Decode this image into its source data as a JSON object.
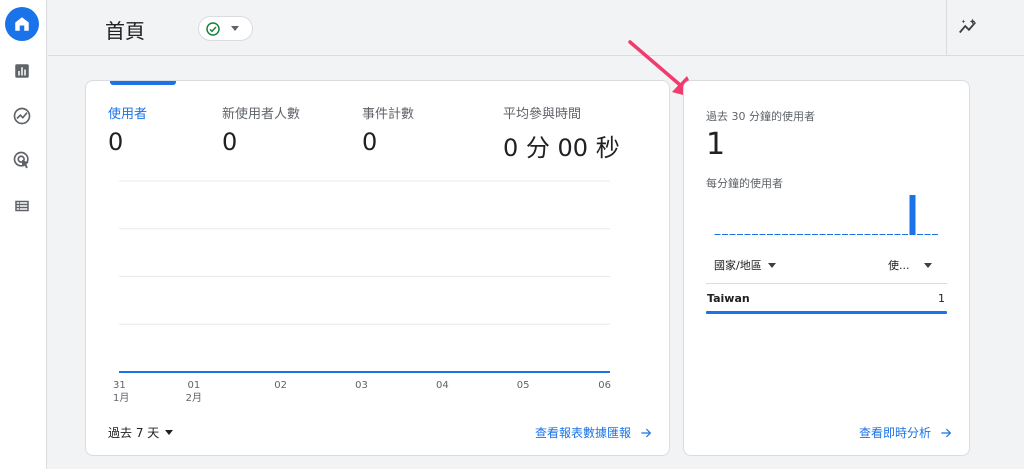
{
  "header": {
    "title": "首頁"
  },
  "sidenav": {
    "items": [
      {
        "icon": "home-icon",
        "active": true
      },
      {
        "icon": "reports-icon"
      },
      {
        "icon": "explore-icon"
      },
      {
        "icon": "advertising-icon"
      },
      {
        "icon": "configure-icon"
      }
    ]
  },
  "overview": {
    "metrics": [
      {
        "label": "使用者",
        "value": "0"
      },
      {
        "label": "新使用者人數",
        "value": "0"
      },
      {
        "label": "事件計數",
        "value": "0"
      },
      {
        "label": "平均參與時間",
        "value": "0 分 00 秒"
      }
    ],
    "date_range": "過去 7 天",
    "view_reports_link": "查看報表數據匯報"
  },
  "chart_data": {
    "type": "line",
    "x_day": [
      "31",
      "01",
      "02",
      "03",
      "04",
      "05",
      "06"
    ],
    "x_month": [
      "1月",
      "2月",
      "",
      "",
      "",
      "",
      ""
    ],
    "series": [
      {
        "values": [
          0,
          0,
          0,
          0,
          0,
          0,
          0
        ]
      }
    ]
  },
  "realtime": {
    "title": "過去 30 分鐘的使用者",
    "value": "1",
    "per_minute_label": "每分鐘的使用者",
    "per_minute_values": [
      0,
      0,
      0,
      0,
      0,
      0,
      0,
      0,
      0,
      0,
      0,
      0,
      0,
      0,
      0,
      0,
      0,
      0,
      0,
      0,
      0,
      0,
      0,
      0,
      0,
      0,
      1,
      0,
      0,
      0
    ],
    "col_country": "國家/地區",
    "col_users": "使...",
    "rows": [
      {
        "country": "Taiwan",
        "users": "1"
      }
    ],
    "view_realtime_link": "查看即時分析"
  },
  "colors": {
    "accent": "#1a73e8",
    "annotation_arrow": "#f23b6c",
    "status_ok": "#188038"
  }
}
